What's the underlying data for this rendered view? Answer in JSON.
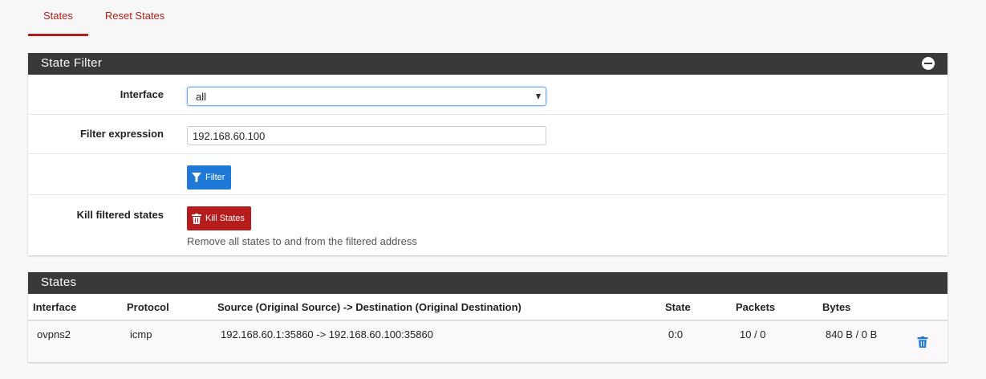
{
  "tabs": [
    {
      "label": "States",
      "active": true
    },
    {
      "label": "Reset States",
      "active": false
    }
  ],
  "state_filter": {
    "title": "State Filter",
    "collapse_icon": "minus-circle-icon",
    "interface_label": "Interface",
    "interface_value": "all",
    "filter_label": "Filter expression",
    "filter_value": "192.168.60.100",
    "filter_button": "Filter",
    "kill_label": "Kill filtered states",
    "kill_button": "Kill States",
    "kill_help": "Remove all states to and from the filtered address"
  },
  "states": {
    "title": "States",
    "columns": [
      "Interface",
      "Protocol",
      "Source (Original Source) -> Destination (Original Destination)",
      "State",
      "Packets",
      "Bytes"
    ],
    "rows": [
      {
        "interface": "ovpns2",
        "protocol": "icmp",
        "source_dest": "192.168.60.1:35860 -> 192.168.60.100:35860",
        "state": "0:0",
        "packets": "10 / 0",
        "bytes": "840 B / 0 B"
      }
    ]
  },
  "colors": {
    "accent": "#b71c1c",
    "panel_header": "#393939",
    "primary": "#1e7ad6",
    "danger": "#b71c1c"
  }
}
